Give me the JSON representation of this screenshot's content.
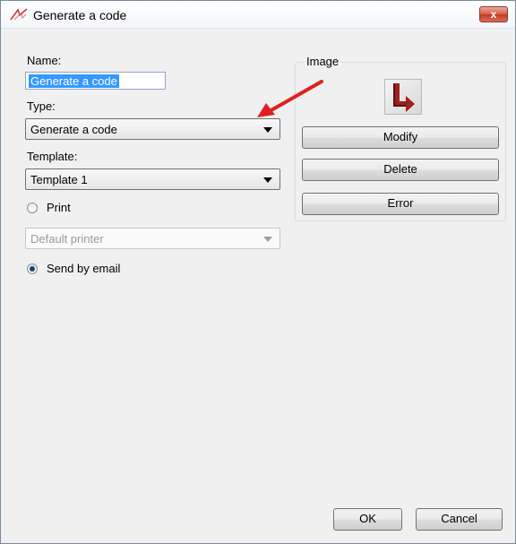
{
  "window": {
    "title": "Generate a code",
    "close_label": "x"
  },
  "form": {
    "name_label": "Name:",
    "name_value": "Generate a code",
    "type_label": "Type:",
    "type_value": "Generate a code",
    "template_label": "Template:",
    "template_value": "Template 1",
    "print_label": "Print",
    "printer_value": "Default printer",
    "email_label": "Send by email",
    "delivery_selected": "Send by email"
  },
  "image_group": {
    "title": "Image",
    "modify_label": "Modify",
    "delete_label": "Delete",
    "error_label": "Error"
  },
  "footer": {
    "ok_label": "OK",
    "cancel_label": "Cancel"
  },
  "colors": {
    "annotation_arrow": "#e02020",
    "selection": "#3399ff"
  },
  "icons": {
    "app": "app-logo-icon",
    "image_preview": "arrow-shape-image-icon"
  }
}
